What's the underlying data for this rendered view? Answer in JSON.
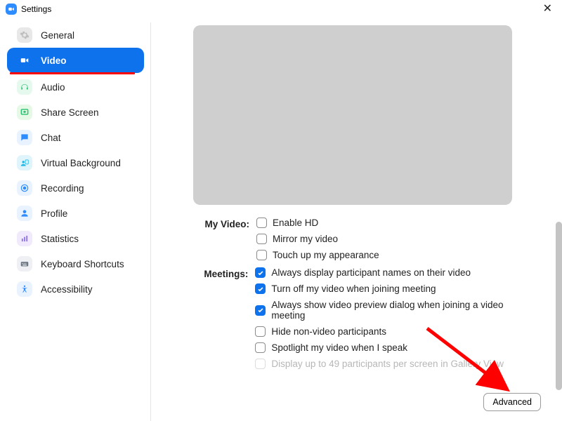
{
  "window": {
    "title": "Settings"
  },
  "sidebar": {
    "items": [
      {
        "label": "General"
      },
      {
        "label": "Video"
      },
      {
        "label": "Audio"
      },
      {
        "label": "Share Screen"
      },
      {
        "label": "Chat"
      },
      {
        "label": "Virtual Background"
      },
      {
        "label": "Recording"
      },
      {
        "label": "Profile"
      },
      {
        "label": "Statistics"
      },
      {
        "label": "Keyboard Shortcuts"
      },
      {
        "label": "Accessibility"
      }
    ]
  },
  "main": {
    "groups": {
      "my_video": {
        "title": "My Video:",
        "options": [
          {
            "label": "Enable HD"
          },
          {
            "label": "Mirror my video"
          },
          {
            "label": "Touch up my appearance"
          }
        ]
      },
      "meetings": {
        "title": "Meetings:",
        "options": [
          {
            "label": "Always display participant names on their video"
          },
          {
            "label": "Turn off my video when joining meeting"
          },
          {
            "label": "Always show video preview dialog when joining a video meeting"
          },
          {
            "label": "Hide non-video participants"
          },
          {
            "label": "Spotlight my video when I speak"
          },
          {
            "label": "Display up to 49 participants per screen in Gallery View"
          }
        ]
      }
    },
    "advanced_button": "Advanced"
  }
}
